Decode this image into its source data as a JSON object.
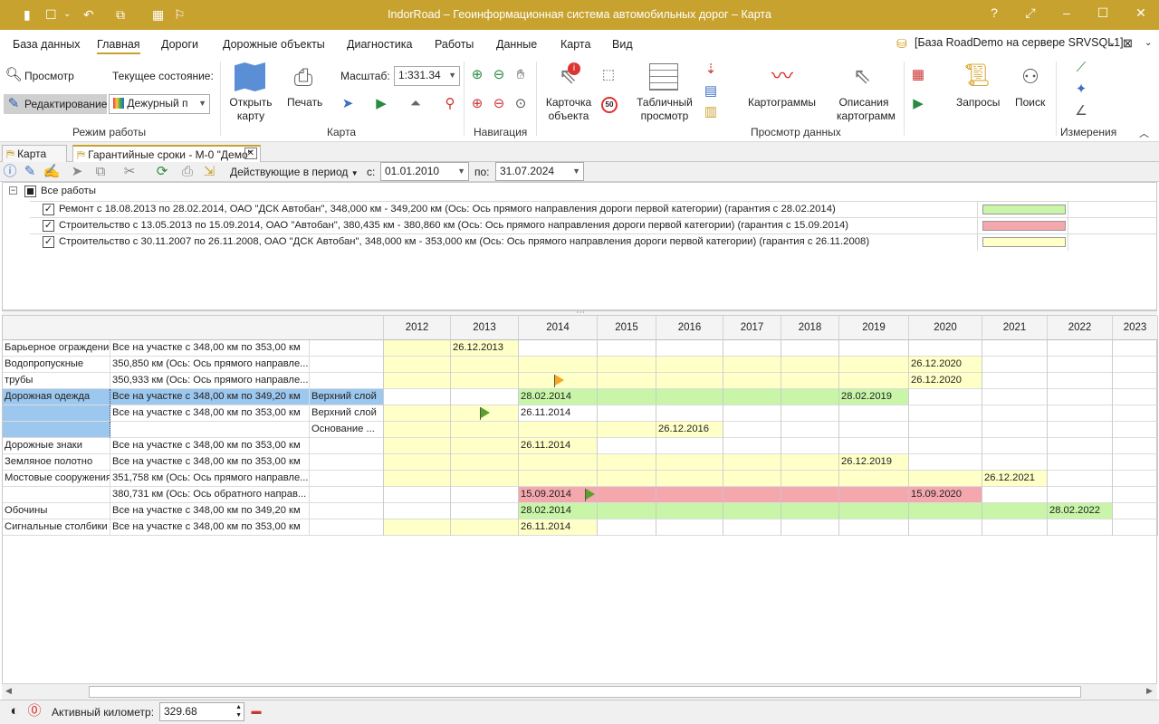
{
  "app": {
    "title": "IndorRoad – Геоинформационная система автомобильных дорог – Карта"
  },
  "menu": {
    "items": [
      "База данных",
      "Главная",
      "Дороги",
      "Дорожные объекты",
      "Диагностика",
      "Работы",
      "Данные",
      "Карта",
      "Вид"
    ],
    "db_info": "[База RoadDemo на сервере SRVSQL1]"
  },
  "ribbon": {
    "mode_view": "Просмотр",
    "mode_edit": "Редактирование",
    "current_state_label": "Текущее состояние:",
    "current_state_value": "Дежурный п",
    "group_mode": "Режим работы",
    "open_map": "Открыть\nкарту",
    "print": "Печать",
    "scale_label": "Масштаб:",
    "scale_value": "1:331.34",
    "group_map": "Карта",
    "group_nav": "Навигация",
    "object_card": "Карточка\nобъекта",
    "table_view": "Табличный\nпросмотр",
    "cartograms": "Картограммы",
    "cartogram_desc": "Описания\nкартограмм",
    "group_data": "Просмотр данных",
    "queries": "Запросы",
    "search": "Поиск",
    "group_measure": "Измерения"
  },
  "tabs": [
    {
      "label": "Карта",
      "active": false
    },
    {
      "label": "Гарантийные сроки - М-0 \"Демо\"",
      "active": true
    }
  ],
  "filter": {
    "period_label": "Действующие в период",
    "from_label": "с:",
    "from_value": "01.01.2010",
    "to_label": "по:",
    "to_value": "31.07.2024"
  },
  "tree": {
    "root": "Все работы",
    "items": [
      {
        "text": "Ремонт с 18.08.2013 по 28.02.2014, ОАО \"ДСК Автобан\", 348,000 км - 349,200 км  (Ось: Ось прямого направления дороги первой категории) (гарантия с 28.02.2014)",
        "color": "#c8f5a8",
        "checked": true
      },
      {
        "text": "Строительство с 13.05.2013 по 15.09.2014, ОАО \"Автобан\", 380,435 км - 380,860 км  (Ось: Ось прямого направления дороги первой категории) (гарантия с 15.09.2014)",
        "color": "#f4a7ad",
        "checked": true
      },
      {
        "text": "Строительство с 30.11.2007 по 26.11.2008, ОАО \"ДСК Автобан\", 348,000 км - 353,000 км  (Ось: Ось прямого направления дороги первой категории) (гарантия с 26.11.2008)",
        "color": "#ffffc8",
        "checked": true
      }
    ]
  },
  "years": [
    "2012",
    "2013",
    "2014",
    "2015",
    "2016",
    "2017",
    "2018",
    "2019",
    "2020",
    "2021",
    "2022",
    "2023"
  ],
  "grid_rows": [
    {
      "c1": "Барьерное ограждение",
      "c2": "Все на участке с 348,00 км по 353,00 км",
      "c3": ""
    },
    {
      "c1": "Водопропускные",
      "c2": "350,850 км (Ось: Ось прямого направле...",
      "c3": ""
    },
    {
      "c1": "трубы",
      "c2": "350,933 км (Ось: Ось прямого направле...",
      "c3": ""
    },
    {
      "c1": "Дорожная одежда",
      "c2": "Все на участке с 348,00 км по 349,20 км",
      "c3": "Верхний слой"
    },
    {
      "c1": "",
      "c2": "Все на участке с 348,00 км по 353,00 км",
      "c3": "Верхний слой"
    },
    {
      "c1": "",
      "c2": "",
      "c3": "Основание ..."
    },
    {
      "c1": "Дорожные знаки",
      "c2": "Все на участке с 348,00 км по 353,00 км",
      "c3": ""
    },
    {
      "c1": "Земляное полотно",
      "c2": "Все на участке с 348,00 км по 353,00 км",
      "c3": ""
    },
    {
      "c1": "Мостовые сооружения",
      "c2": "351,758 км (Ось: Ось прямого направле...",
      "c3": ""
    },
    {
      "c1": "",
      "c2": "380,731 км (Ось: Ось обратного направ...",
      "c3": ""
    },
    {
      "c1": "Обочины",
      "c2": "Все на участке с 348,00 км по 349,20 км",
      "c3": ""
    },
    {
      "c1": "Сигнальные столбики",
      "c2": "Все на участке с 348,00 км по 353,00 км",
      "c3": ""
    }
  ],
  "bars": [
    {
      "row": 0,
      "start": "2012",
      "end": "2014",
      "color": "#ffffc8",
      "label": "",
      "label_year": ""
    },
    {
      "row": 0,
      "start": "2013",
      "end": "2014",
      "color": "#ffffc8",
      "label": "26.12.2013",
      "label_year": "2013"
    },
    {
      "row": 1,
      "start": "2012",
      "end": "2021",
      "color": "#ffffc8",
      "label": "26.12.2020",
      "label_year": "2020"
    },
    {
      "row": 2,
      "start": "2012",
      "end": "2021",
      "color": "#ffffc8",
      "label": "26.12.2020",
      "label_year": "2020"
    },
    {
      "row": 3,
      "start": "2014",
      "end": "2020",
      "color": "#c8f5a8",
      "label": "28.02.2014",
      "label_year": "2014"
    },
    {
      "row": 3,
      "start": "2019",
      "end": "2020",
      "color": "#c8f5a8",
      "label": "28.02.2019",
      "label_year": "2019"
    },
    {
      "row": 4,
      "start": "2012",
      "end": "2014",
      "color": "#ffffc8",
      "label": "",
      "label_year": ""
    },
    {
      "row": 4,
      "start": "2014",
      "end": "2015",
      "color": "#ffffff",
      "label": "26.11.2014",
      "label_year": "2014"
    },
    {
      "row": 5,
      "start": "2012",
      "end": "2017",
      "color": "#ffffc8",
      "label": "26.12.2016",
      "label_year": "2016"
    },
    {
      "row": 6,
      "start": "2012",
      "end": "2015",
      "color": "#ffffc8",
      "label": "26.11.2014",
      "label_year": "2014"
    },
    {
      "row": 7,
      "start": "2012",
      "end": "2020",
      "color": "#ffffc8",
      "label": "26.12.2019",
      "label_year": "2019"
    },
    {
      "row": 8,
      "start": "2012",
      "end": "2022",
      "color": "#ffffc8",
      "label": "26.12.2021",
      "label_year": "2021"
    },
    {
      "row": 9,
      "start": "2014",
      "end": "2021",
      "color": "#f4a7ad",
      "label": "15.09.2014",
      "label_year": "2014"
    },
    {
      "row": 9,
      "start": "2020",
      "end": "2021",
      "color": "#f4a7ad",
      "label": "15.09.2020",
      "label_year": "2020"
    },
    {
      "row": 10,
      "start": "2014",
      "end": "2023",
      "color": "#c8f5a8",
      "label": "28.02.2014",
      "label_year": "2014"
    },
    {
      "row": 10,
      "start": "2022",
      "end": "2023",
      "color": "#c8f5a8",
      "label": "28.02.2022",
      "label_year": "2022"
    },
    {
      "row": 11,
      "start": "2012",
      "end": "2015",
      "color": "#ffffc8",
      "label": "26.11.2014",
      "label_year": "2014"
    }
  ],
  "status": {
    "active_km_label": "Активный километр:",
    "active_km_value": "329.68"
  }
}
